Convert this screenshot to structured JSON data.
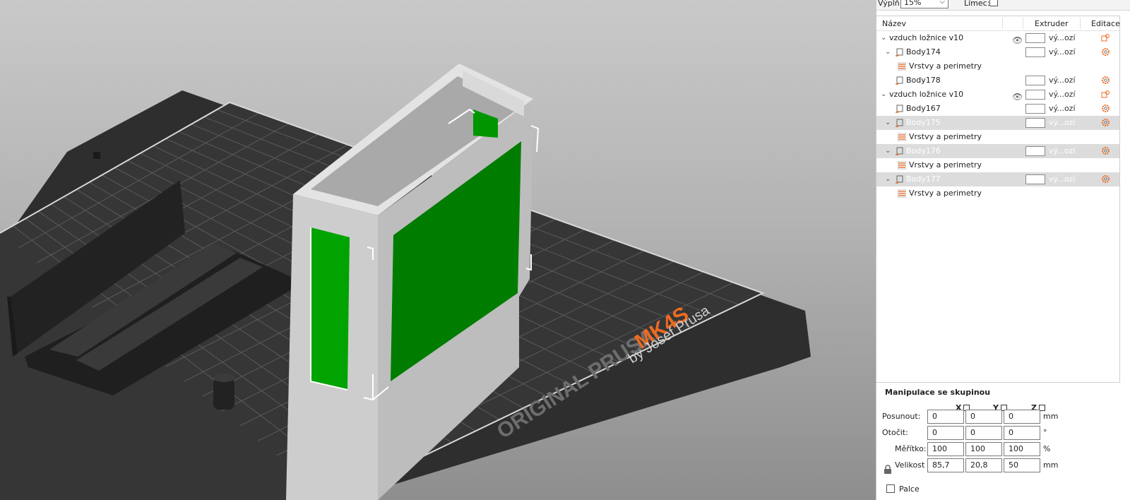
{
  "top_controls": {
    "infill_label": "Výplň:",
    "infill_value": "15%",
    "brim_label": "Límec:"
  },
  "object_list": {
    "columns": {
      "name": "Název",
      "extruder": "Extruder",
      "edit": "Editace"
    },
    "rows": [
      {
        "level": 0,
        "name": "vzduch ložnice v10",
        "toggle": "expanded",
        "icon": "none",
        "eye": true,
        "extruder": "vý...ozí",
        "edit": "object-edit-icon",
        "selected": false
      },
      {
        "level": 1,
        "name": "Body174",
        "toggle": "expanded",
        "icon": "part-icon",
        "eye": false,
        "extruder": "vý...ozí",
        "edit": "settings-gear-icon",
        "selected": false
      },
      {
        "level": 2,
        "name": "Vrstvy a perimetry",
        "toggle": "none",
        "icon": "layers-icon",
        "eye": false,
        "extruder": "",
        "edit": "",
        "selected": false
      },
      {
        "level": 1,
        "name": "Body178",
        "toggle": "none",
        "icon": "part-icon",
        "eye": false,
        "extruder": "vý...ozí",
        "edit": "settings-gear-icon",
        "selected": false
      },
      {
        "level": 0,
        "name": "vzduch ložnice v10",
        "toggle": "expanded",
        "icon": "none",
        "eye": true,
        "extruder": "vý...ozí",
        "edit": "object-edit-icon",
        "selected": false
      },
      {
        "level": 1,
        "name": "Body167",
        "toggle": "none",
        "icon": "part-icon",
        "eye": false,
        "extruder": "vý...ozí",
        "edit": "settings-gear-icon",
        "selected": false
      },
      {
        "level": 1,
        "name": "Body175",
        "toggle": "expanded",
        "icon": "part-icon",
        "eye": false,
        "extruder": "vý...ozí",
        "edit": "settings-gear-icon",
        "selected": true
      },
      {
        "level": 2,
        "name": "Vrstvy a perimetry",
        "toggle": "none",
        "icon": "layers-icon",
        "eye": false,
        "extruder": "",
        "edit": "",
        "selected": false
      },
      {
        "level": 1,
        "name": "Body176",
        "toggle": "expanded",
        "icon": "part-icon",
        "eye": false,
        "extruder": "vý...ozí",
        "edit": "settings-gear-icon",
        "selected": true
      },
      {
        "level": 2,
        "name": "Vrstvy a perimetry",
        "toggle": "none",
        "icon": "layers-icon",
        "eye": false,
        "extruder": "",
        "edit": "",
        "selected": false
      },
      {
        "level": 1,
        "name": "Body177",
        "toggle": "expanded",
        "icon": "part-icon",
        "eye": false,
        "extruder": "vý...ozí",
        "edit": "settings-gear-icon",
        "selected": true
      },
      {
        "level": 2,
        "name": "Vrstvy a perimetry",
        "toggle": "none",
        "icon": "layers-icon",
        "eye": false,
        "extruder": "",
        "edit": "",
        "selected": false
      }
    ]
  },
  "manipulation": {
    "title": "Manipulace se skupinou",
    "axes": [
      "X",
      "Y",
      "Z"
    ],
    "rows": [
      {
        "label": "Posunout:",
        "values": [
          "0",
          "0",
          "0"
        ],
        "unit": "mm"
      },
      {
        "label": "Otočit:",
        "values": [
          "0",
          "0",
          "0"
        ],
        "unit": "°"
      },
      {
        "label": "Měřítko:",
        "values": [
          "100",
          "100",
          "100"
        ],
        "unit": "%"
      },
      {
        "label": "Velikost [Svět]:",
        "values": [
          "85,7",
          "20,8",
          "50"
        ],
        "unit": "mm"
      }
    ],
    "inches_label": "Palce"
  },
  "bed": {
    "brand_text": "ORIGINAL PRUSA",
    "model_text": "MK4S",
    "byline": "by Josef Prusa"
  },
  "colors": {
    "accent_orange": "#ed6b21",
    "model_green": "#00a000",
    "bed_dark": "#2f2f2f",
    "model_gray": "#c9c9c9"
  }
}
